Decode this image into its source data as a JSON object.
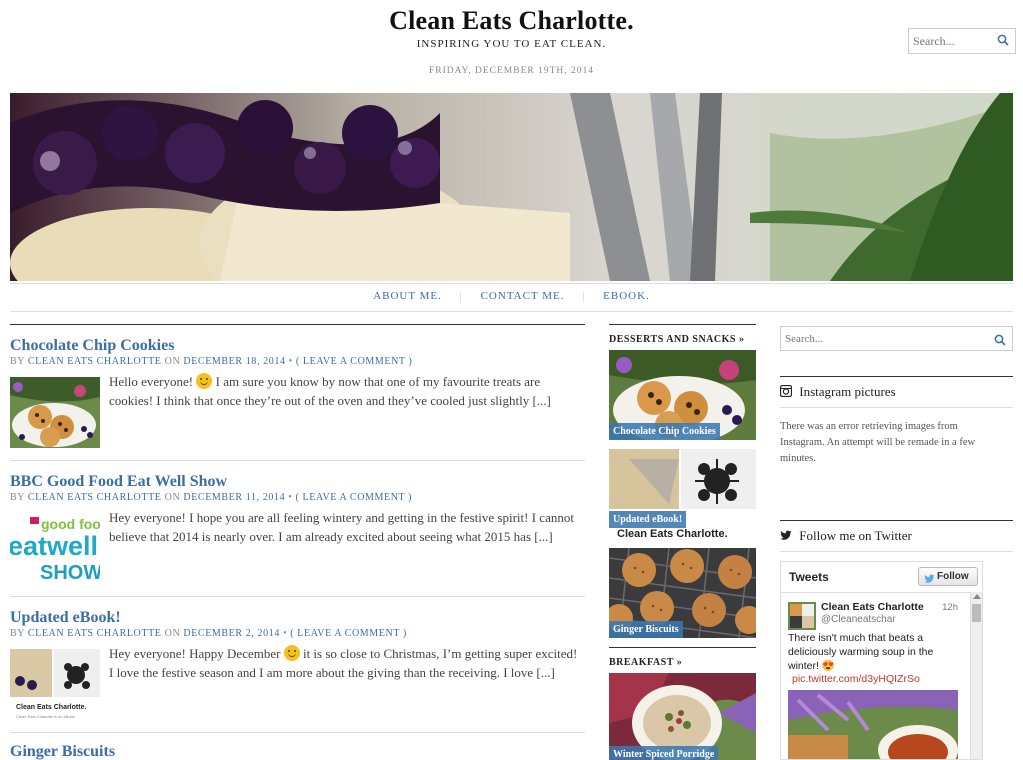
{
  "header": {
    "site_title": "Clean Eats Charlotte.",
    "tagline": "INSPIRING YOU TO EAT CLEAN.",
    "date": "FRIDAY, DECEMBER 19TH, 2014",
    "search_placeholder": "Search..."
  },
  "nav": {
    "items": [
      "ABOUT ME.",
      "CONTACT ME.",
      "EBOOK."
    ],
    "separator": "|"
  },
  "posts": [
    {
      "title": "Chocolate Chip Cookies",
      "by": "BY",
      "author": "CLEAN EATS CHARLOTTE",
      "on": "ON",
      "date": "DECEMBER 18, 2014",
      "dot": "•",
      "comment_link": "( LEAVE A COMMENT )",
      "excerpt_a": "Hello everyone!",
      "excerpt_b": "I am sure you know by now that one of my favourite treats are cookies! I think that once they’re out of the oven and they’ve cooled just slightly [...]"
    },
    {
      "title": "BBC Good Food Eat Well Show",
      "by": "BY",
      "author": "CLEAN EATS CHARLOTTE",
      "on": "ON",
      "date": "DECEMBER 11, 2014",
      "dot": "•",
      "comment_link": "( LEAVE A COMMENT )",
      "excerpt": "Hey everyone! I hope you are all feeling wintery and getting in the festive spirit! I cannot believe that 2014 is nearly over. I am already excited about seeing what 2015 has [...]",
      "thumb_text": {
        "line1": "good food",
        "line2": "eatwell",
        "line3": "SHOW"
      }
    },
    {
      "title": "Updated eBook!",
      "by": "BY",
      "author": "CLEAN EATS CHARLOTTE",
      "on": "ON",
      "date": "DECEMBER 2, 2014",
      "dot": "•",
      "comment_link": "( LEAVE A COMMENT )",
      "excerpt_a": "Hey everyone! Happy December",
      "excerpt_b": "it is so close to Christmas, I’m getting super excited! I love the festive season and I am more about the giving than the receiving. I love [...]",
      "thumb_text": {
        "title": "Clean Eats Charlotte.",
        "sub": "Clean Eats Charlotte is an eBook"
      }
    }
  ],
  "last_post_title": "Ginger Biscuits",
  "categories": [
    {
      "name": "DESSERTS AND SNACKS",
      "arrow": "»",
      "items": [
        "Chocolate Chip Cookies",
        "Updated eBook!",
        "Ginger Biscuits"
      ],
      "ebook_overlay": "Clean Eats Charlotte."
    },
    {
      "name": "BREAKFAST",
      "arrow": "»",
      "items": [
        "Winter Spiced Porridge"
      ]
    }
  ],
  "sidebar": {
    "search_placeholder": "Search...",
    "instagram_title": "Instagram pictures",
    "instagram_error": "There was an error retrieving images from Instagram. An attempt will be remade in a few minutes.",
    "twitter_title": "Follow me on Twitter",
    "tweets_heading": "Tweets",
    "follow_label": "Follow",
    "tweet": {
      "name": "Clean Eats Charlotte",
      "handle": "@Cleaneatschar",
      "time": "12h",
      "text": "There isn't much that beats a deliciously warming soup in the winter! 😍",
      "link": "pic.twitter.com/d3yHQIZrSo"
    }
  },
  "colors": {
    "link": "#3a6ea5",
    "label_bg": "#3a78af"
  }
}
